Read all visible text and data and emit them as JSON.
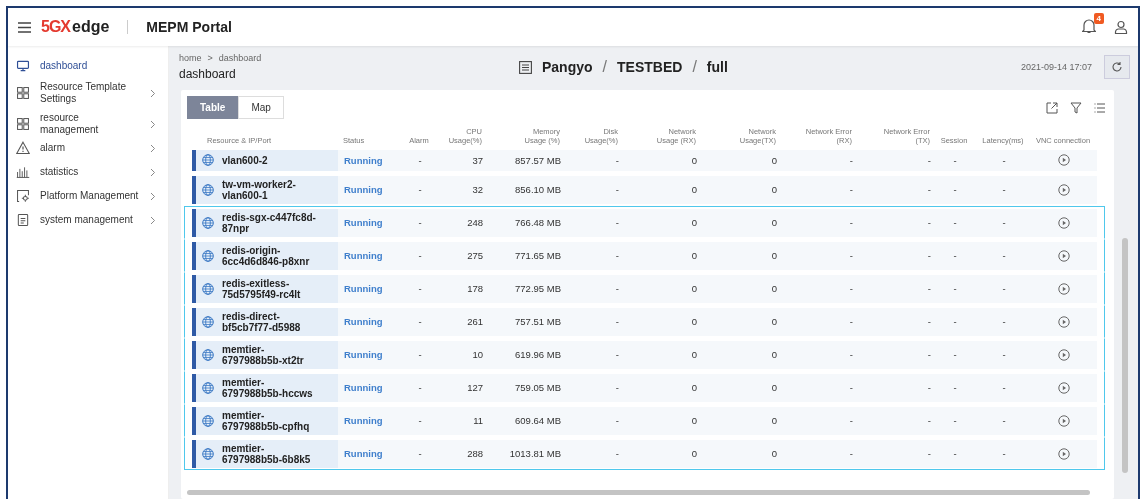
{
  "header": {
    "logo_mark": "5GX",
    "logo_text": "edge",
    "title": "MEPM Portal",
    "notification_count": "4"
  },
  "sidebar": {
    "items": [
      {
        "label": "dashboard",
        "selected": true,
        "has_submenu": false
      },
      {
        "label": "Resource Template Settings",
        "selected": false,
        "has_submenu": true
      },
      {
        "label": "resource management",
        "selected": false,
        "has_submenu": true
      },
      {
        "label": "alarm",
        "selected": false,
        "has_submenu": true
      },
      {
        "label": "statistics",
        "selected": false,
        "has_submenu": true
      },
      {
        "label": "Platform Management",
        "selected": false,
        "has_submenu": true
      },
      {
        "label": "system management",
        "selected": false,
        "has_submenu": true
      }
    ]
  },
  "breadcrumb": [
    "home",
    ">",
    "dashboard"
  ],
  "page_title": "dashboard",
  "location": [
    "Pangyo",
    "/",
    "TESTBED",
    "/",
    "full"
  ],
  "timestamp": "2021-09-14 17:07",
  "tabs": [
    {
      "label": "Table",
      "selected": true
    },
    {
      "label": "Map",
      "selected": false
    }
  ],
  "table": {
    "columns": [
      "Resource & IP/Port",
      "Status",
      "Alarm",
      "CPU Usage(%)",
      "Memory Usage (%)",
      "Disk Usage(%)",
      "Network Usage (RX)",
      "Network Usage(TX)",
      "Network Error (RX)",
      "Network Error (TX)",
      "Session",
      "Latency(ms)",
      "VNC connection"
    ],
    "rows": [
      {
        "name": "vlan600-2",
        "status": "Running",
        "alarm": "-",
        "cpu": "37",
        "memory": "857.57 MB",
        "disk": "-",
        "net_rx": "0",
        "net_tx": "0",
        "err_rx": "-",
        "err_tx": "-",
        "session": "-",
        "latency": "-",
        "selected": false
      },
      {
        "name": "tw-vm-worker2-vlan600-1",
        "status": "Running",
        "alarm": "-",
        "cpu": "32",
        "memory": "856.10 MB",
        "disk": "-",
        "net_rx": "0",
        "net_tx": "0",
        "err_rx": "-",
        "err_tx": "-",
        "session": "-",
        "latency": "-",
        "selected": false
      },
      {
        "name": "redis-sgx-c447fc8d-87npr",
        "status": "Running",
        "alarm": "-",
        "cpu": "248",
        "memory": "766.48 MB",
        "disk": "-",
        "net_rx": "0",
        "net_tx": "0",
        "err_rx": "-",
        "err_tx": "-",
        "session": "-",
        "latency": "-",
        "selected": true
      },
      {
        "name": "redis-origin-6cc4d6d846-p8xnr",
        "status": "Running",
        "alarm": "-",
        "cpu": "275",
        "memory": "771.65 MB",
        "disk": "-",
        "net_rx": "0",
        "net_tx": "0",
        "err_rx": "-",
        "err_tx": "-",
        "session": "-",
        "latency": "-",
        "selected": true
      },
      {
        "name": "redis-exitless-75d5795f49-rc4lt",
        "status": "Running",
        "alarm": "-",
        "cpu": "178",
        "memory": "772.95 MB",
        "disk": "-",
        "net_rx": "0",
        "net_tx": "0",
        "err_rx": "-",
        "err_tx": "-",
        "session": "-",
        "latency": "-",
        "selected": true
      },
      {
        "name": "redis-direct-bf5cb7f77-d5988",
        "status": "Running",
        "alarm": "-",
        "cpu": "261",
        "memory": "757.51 MB",
        "disk": "-",
        "net_rx": "0",
        "net_tx": "0",
        "err_rx": "-",
        "err_tx": "-",
        "session": "-",
        "latency": "-",
        "selected": true
      },
      {
        "name": "memtier-6797988b5b-xt2tr",
        "status": "Running",
        "alarm": "-",
        "cpu": "10",
        "memory": "619.96 MB",
        "disk": "-",
        "net_rx": "0",
        "net_tx": "0",
        "err_rx": "-",
        "err_tx": "-",
        "session": "-",
        "latency": "-",
        "selected": true
      },
      {
        "name": "memtier-6797988b5b-hccws",
        "status": "Running",
        "alarm": "-",
        "cpu": "127",
        "memory": "759.05 MB",
        "disk": "-",
        "net_rx": "0",
        "net_tx": "0",
        "err_rx": "-",
        "err_tx": "-",
        "session": "-",
        "latency": "-",
        "selected": true
      },
      {
        "name": "memtier-6797988b5b-cpfhq",
        "status": "Running",
        "alarm": "-",
        "cpu": "11",
        "memory": "609.64 MB",
        "disk": "-",
        "net_rx": "0",
        "net_tx": "0",
        "err_rx": "-",
        "err_tx": "-",
        "session": "-",
        "latency": "-",
        "selected": true
      },
      {
        "name": "memtier-6797988b5b-6b8k5",
        "status": "Running",
        "alarm": "-",
        "cpu": "288",
        "memory": "1013.81 MB",
        "disk": "-",
        "net_rx": "0",
        "net_tx": "0",
        "err_rx": "-",
        "err_tx": "-",
        "session": "-",
        "latency": "-",
        "selected": true
      }
    ]
  }
}
